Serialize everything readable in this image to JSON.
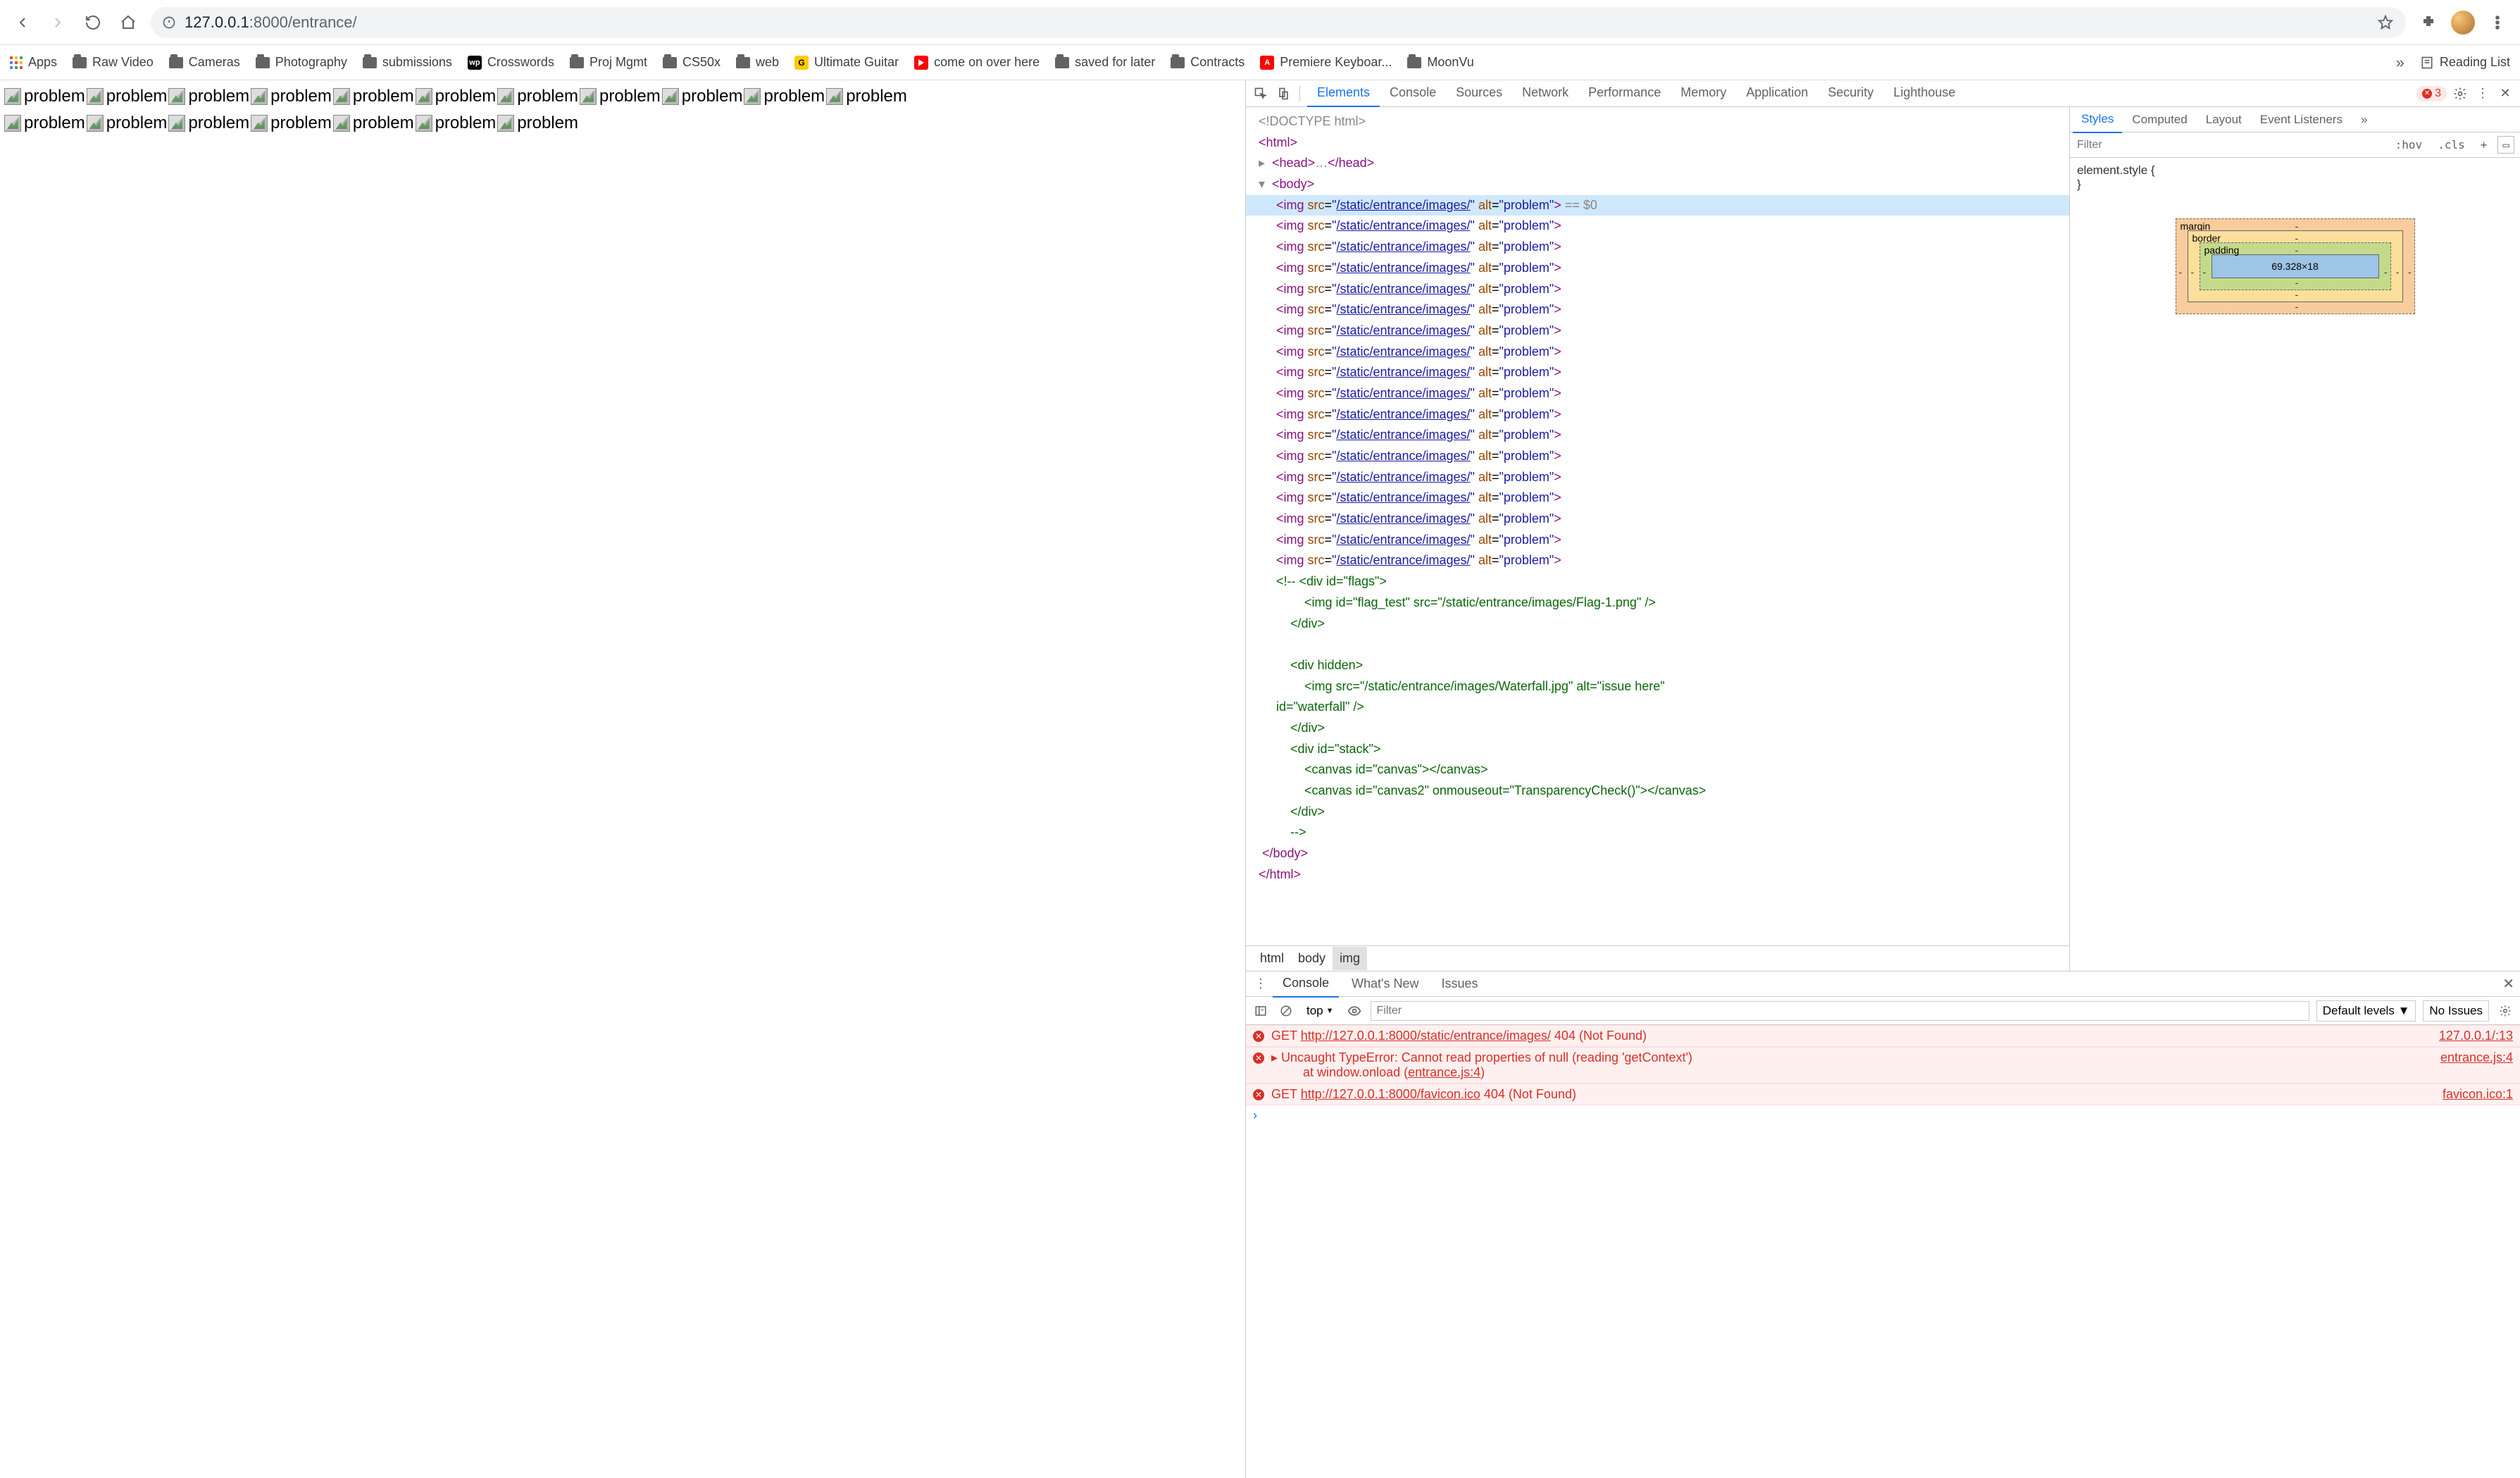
{
  "browser": {
    "url_host": "127.0.0.1",
    "url_port": ":8000",
    "url_path": "/entrance/"
  },
  "bookmarks": {
    "items": [
      {
        "label": "Apps",
        "icon": "dots"
      },
      {
        "label": "Raw Video",
        "icon": "folder"
      },
      {
        "label": "Cameras",
        "icon": "folder"
      },
      {
        "label": "Photography",
        "icon": "folder"
      },
      {
        "label": "submissions",
        "icon": "folder"
      },
      {
        "label": "Crosswords",
        "icon": "wp"
      },
      {
        "label": "Proj Mgmt",
        "icon": "folder"
      },
      {
        "label": "CS50x",
        "icon": "folder"
      },
      {
        "label": "web",
        "icon": "folder"
      },
      {
        "label": "Ultimate Guitar",
        "icon": "ug"
      },
      {
        "label": "come on over here",
        "icon": "yt"
      },
      {
        "label": "saved for later",
        "icon": "folder"
      },
      {
        "label": "Contracts",
        "icon": "folder"
      },
      {
        "label": "Premiere Keyboar...",
        "icon": "adobe"
      },
      {
        "label": "MoonVu",
        "icon": "folder"
      }
    ],
    "overflow": "»",
    "reading_list": "Reading List"
  },
  "page": {
    "broken_alt": "problem",
    "broken_count": 18
  },
  "devtools": {
    "tabs": [
      "Elements",
      "Console",
      "Sources",
      "Network",
      "Performance",
      "Memory",
      "Application",
      "Security",
      "Lighthouse"
    ],
    "selected_tab": "Elements",
    "error_count": "3",
    "dom": {
      "doctype": "<!DOCTYPE html>",
      "html_open": "<html>",
      "head": {
        "open": "<head>",
        "ell": "…",
        "close": "</head>"
      },
      "body_open": "<body>",
      "img_line": {
        "tag": "img",
        "src_attr": "src",
        "src_val": "/static/entrance/images/",
        "alt_attr": "alt",
        "alt_val": "problem",
        "eq_sel": " == $0"
      },
      "img_repeat": 17,
      "comment_lines": [
        "<!-- <div id=\"flags\">",
        "        <img id=\"flag_test\" src=\"/static/entrance/images/Flag-1.png\" />",
        "    </div>",
        "",
        "    <div hidden>",
        "        <img src=\"/static/entrance/images/Waterfall.jpg\" alt=\"issue here\"",
        "id=\"waterfall\" />",
        "    </div>",
        "    <div id=\"stack\">",
        "        <canvas id=\"canvas\"></canvas>",
        "        <canvas id=\"canvas2\" onmouseout=\"TransparencyCheck()\"></canvas>",
        "    </div>",
        "    -->"
      ],
      "body_close": "</body>",
      "html_close": "</html>"
    },
    "crumb": [
      "html",
      "body",
      "img"
    ],
    "styles": {
      "tabs": [
        "Styles",
        "Computed",
        "Layout",
        "Event Listeners"
      ],
      "selected": "Styles",
      "filter_placeholder": "Filter",
      "hov": ":hov",
      "cls": ".cls",
      "rule": "element.style {",
      "rule_close": "}",
      "box": {
        "margin": "margin",
        "border": "border",
        "padding": "padding",
        "content": "69.328×18",
        "dash": "-"
      }
    },
    "drawer": {
      "tabs": [
        "Console",
        "What's New",
        "Issues"
      ],
      "selected": "Console",
      "context": "top",
      "filter_placeholder": "Filter",
      "levels": "Default levels",
      "no_issues": "No Issues",
      "msgs": [
        {
          "type": "err",
          "pre": "GET ",
          "url": "http://127.0.0.1:8000/static/entrance/images/",
          "post": " 404 (Not Found)",
          "src": "127.0.0.1/:13"
        },
        {
          "type": "err",
          "expand": true,
          "text": "Uncaught TypeError: Cannot read properties of null (reading 'getContext')\n    at window.onload (",
          "link": "entrance.js:4",
          "after": ")",
          "src": "entrance.js:4"
        },
        {
          "type": "err",
          "pre": "GET ",
          "url": "http://127.0.0.1:8000/favicon.ico",
          "post": " 404 (Not Found)",
          "src": "favicon.ico:1"
        }
      ]
    }
  }
}
